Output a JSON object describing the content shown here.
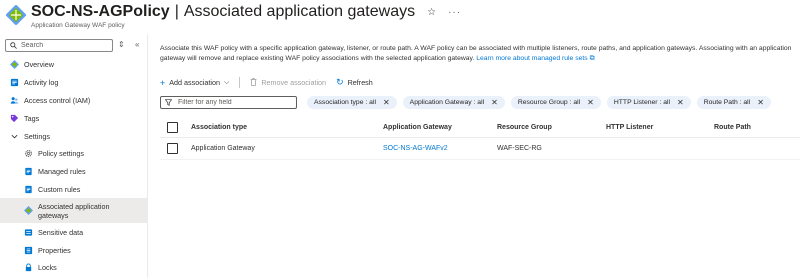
{
  "header": {
    "title": "SOC-NS-AGPolicy",
    "page_title": "Associated application gateways",
    "subtitle": "Application Gateway WAF policy",
    "separator": "|",
    "star_glyph": "☆",
    "more_glyph": "···"
  },
  "sidebar": {
    "search_placeholder": "Search",
    "items": [
      {
        "label": "Overview",
        "icon": "waf-policy-icon"
      },
      {
        "label": "Activity log",
        "icon": "activity-log-icon"
      },
      {
        "label": "Access control (IAM)",
        "icon": "iam-icon"
      },
      {
        "label": "Tags",
        "icon": "tag-icon"
      },
      {
        "label": "Settings",
        "icon": "chevron-down-icon"
      },
      {
        "label": "Policy settings",
        "icon": "gear-icon"
      },
      {
        "label": "Managed rules",
        "icon": "managed-rules-icon"
      },
      {
        "label": "Custom rules",
        "icon": "custom-rules-icon"
      },
      {
        "label": "Associated application gateways",
        "icon": "waf-policy-icon"
      },
      {
        "label": "Sensitive data",
        "icon": "sensitive-data-icon"
      },
      {
        "label": "Properties",
        "icon": "properties-icon"
      },
      {
        "label": "Locks",
        "icon": "lock-icon"
      }
    ]
  },
  "main": {
    "description": "Associate this WAF policy with a specific application gateway, listener, or route path. A WAF policy can be associated with multiple listeners, route paths, and application gateways. Associating with an application gateway will remove and replace existing WAF policy associations with the selected application gateway.",
    "learn_more": "Learn more about managed rule sets",
    "toolbar": {
      "add_label": "Add association",
      "remove_label": "Remove association",
      "refresh_label": "Refresh"
    },
    "filter_placeholder": "Filter for any field",
    "pills": [
      "Association type : all",
      "Application Gateway : all",
      "Resource Group : all",
      "HTTP Listener : all",
      "Route Path : all"
    ],
    "table": {
      "columns": [
        "Association type",
        "Application Gateway",
        "Resource Group",
        "HTTP Listener",
        "Route Path"
      ],
      "rows": [
        {
          "association_type": "Application Gateway",
          "application_gateway": "SOC-NS-AG-WAFv2",
          "resource_group": "WAF-SEC-RG",
          "http_listener": "",
          "route_path": ""
        }
      ]
    }
  },
  "colors": {
    "accent": "#0078d4",
    "pill_bg": "#eaf1fb",
    "active_nav_bg": "#edebe9",
    "waf_icon": "#5ea0ef"
  }
}
